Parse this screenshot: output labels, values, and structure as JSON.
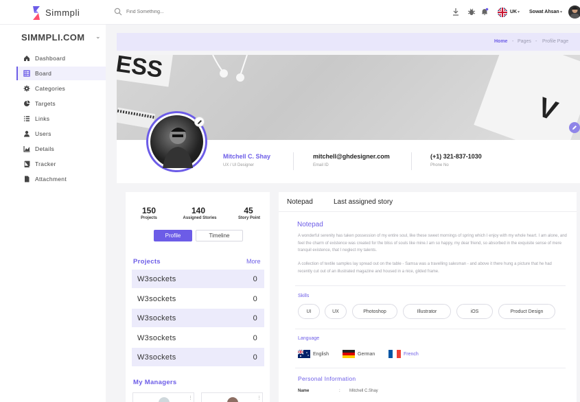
{
  "app": {
    "name": "Simmpli",
    "brand": "SIMMPLI.COM",
    "accent": "#6c5ce7"
  },
  "topbar": {
    "search_placeholder": "Find Something...",
    "icons": [
      "download-icon",
      "bug-icon",
      "bell-icon"
    ],
    "language": "UK",
    "user_name": "Sowat Ahsan"
  },
  "sidebar": {
    "items": [
      {
        "label": "Dashboard",
        "icon": "home-icon"
      },
      {
        "label": "Board",
        "icon": "grid-icon",
        "active": true
      },
      {
        "label": "Categories",
        "icon": "gear-icon"
      },
      {
        "label": "Targets",
        "icon": "pie-icon"
      },
      {
        "label": "Links",
        "icon": "list-icon"
      },
      {
        "label": "Users",
        "icon": "user-icon"
      },
      {
        "label": "Details",
        "icon": "chart-icon"
      },
      {
        "label": "Tracker",
        "icon": "book-icon"
      },
      {
        "label": "Attachment",
        "icon": "file-icon"
      }
    ]
  },
  "breadcrumb": {
    "home": "Home",
    "sep1": "-",
    "pages": "Pages",
    "sep2": "-",
    "current": "Profile Page"
  },
  "profile": {
    "name": "Mitchell C. Shay",
    "role": "UX / UI Designer",
    "email": "mitchell@ghdesigner.com",
    "email_label": "Email ID",
    "phone": "(+1) 321-837-1030",
    "phone_label": "Phone No"
  },
  "stats": [
    {
      "value": "150",
      "label": "Projects"
    },
    {
      "value": "140",
      "label": "Assigned Stories"
    },
    {
      "value": "45",
      "label": "Story Point"
    }
  ],
  "left_tabs": {
    "profile": "Profile",
    "timeline": "Timeline"
  },
  "projects": {
    "title": "Projects",
    "more": "More",
    "rows": [
      {
        "name": "W3sockets",
        "count": "0"
      },
      {
        "name": "W3sockets",
        "count": "0"
      },
      {
        "name": "W3sockets",
        "count": "0"
      },
      {
        "name": "W3sockets",
        "count": "0"
      },
      {
        "name": "W3sockets",
        "count": "0"
      }
    ]
  },
  "managers": {
    "title": "My Managers"
  },
  "right_tabs": {
    "notepad": "Notepad",
    "last_story": "Last assigned story"
  },
  "notepad": {
    "title": "Notepad",
    "para1": "A wonderful serenity has taken possession of my entire soul, like these sweet mornings of spring which I enjoy with my whole heart. I am alone, and feel the charm of existence was created for the bliss of souls like mine.I am so happy, my dear friend, so absorbed in the exquisite sense of mere tranquil existence, that I neglect my talents.",
    "para2": "A collection of textile samples lay spread out on the table - Samsa was a travelling salesman - and above it there hung a picture that he had recently cut out of an illustrated magazine and housed in a nice, gilded frame."
  },
  "skills": {
    "title": "Skills",
    "items": [
      "UI",
      "UX",
      "Photoshop",
      "Illustrator",
      "iOS",
      "Product Design"
    ]
  },
  "language": {
    "title": "Language",
    "items": [
      "English",
      "German",
      "French"
    ]
  },
  "personal": {
    "title": "Personal Information",
    "name_label": "Name",
    "colon": ":",
    "name_value": "Mitchell C.Shay"
  }
}
